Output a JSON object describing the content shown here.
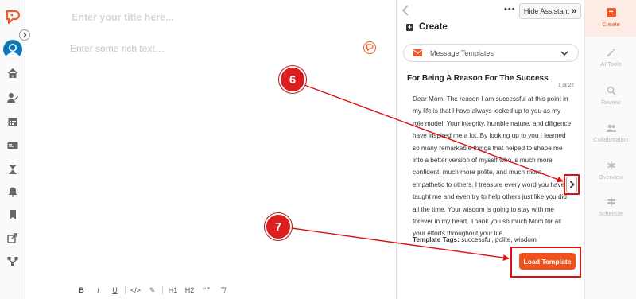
{
  "editor": {
    "title_placeholder": "Enter your title here...",
    "body_placeholder": "Enter some rich text…",
    "toolbar": [
      "B",
      "I",
      "U",
      "</>",
      "✎",
      "H1",
      "H2",
      "“”",
      "T̸"
    ]
  },
  "sidebar": {
    "icons": [
      "home-icon",
      "user-edit-icon",
      "calendar-icon",
      "id-card-icon",
      "hourglass-icon",
      "bell-icon",
      "bookmark-icon",
      "share-icon",
      "network-icon"
    ]
  },
  "assistant": {
    "hide_label": "Hide Assistant",
    "hide_glyph": "»",
    "more_glyph": "•••",
    "create_label": "Create",
    "dropdown_label": "Message Templates",
    "template_title": "For Being A Reason For The Success",
    "template_counter": "1 of 22",
    "template_body": "Dear Mom, The reason I am successful at this point in my life is that I have always looked up to you as my role model. Your integrity, humble nature, and diligence have inspired me a lot. By looking up to you I learned so many remarkable things that helped to shape me into a better version of myself who is much more confident, much more polite, and much more empathetic to others. I treasure every word you have taught me and even try to help others just like you did all the time. Your wisdom is going to stay with me forever in my heart. Thank you so much Mom for all your efforts throughout your life.",
    "tags_label": "Template Tags:",
    "tags_value": "successful, polite, wisdom",
    "load_label": "Load Template"
  },
  "rail": {
    "items": [
      {
        "label": "Create",
        "active": true
      },
      {
        "label": "AI Tools",
        "active": false
      },
      {
        "label": "Review",
        "active": false
      },
      {
        "label": "Collaboration",
        "active": false
      },
      {
        "label": "Overview",
        "active": false
      },
      {
        "label": "Schedule",
        "active": false
      }
    ]
  },
  "annotations": {
    "step_a": "6",
    "step_b": "7",
    "color": "#e01010"
  },
  "colors": {
    "accent": "#f05a28",
    "annotation": "#e01010",
    "avatar": "#0d76b8"
  }
}
